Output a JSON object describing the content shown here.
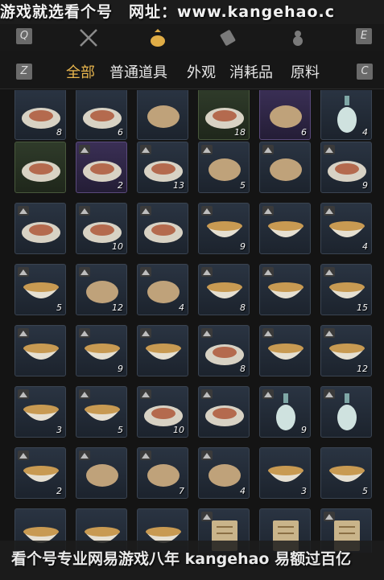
{
  "banner": {
    "text": "游戏就选看个号　网址：www.kangehao.c"
  },
  "keys": {
    "q": "Q",
    "e": "E",
    "z": "Z",
    "c": "C"
  },
  "top_icons": [
    "swords-icon",
    "pouch-icon",
    "scroll-icon",
    "gourd-icon"
  ],
  "categories": [
    {
      "label": "全部",
      "active": true
    },
    {
      "label": "普通道具",
      "active": false
    },
    {
      "label": "外观",
      "active": false
    },
    {
      "label": "消耗品",
      "active": false
    },
    {
      "label": "原料",
      "active": false
    }
  ],
  "items": [
    {
      "icon": "meat-plate-icon",
      "count": "8",
      "badge": false,
      "tier": "normal"
    },
    {
      "icon": "cucumber-plate-icon",
      "count": "6",
      "badge": false,
      "tier": "normal"
    },
    {
      "icon": "roast-meat-icon",
      "count": "",
      "badge": false,
      "tier": "normal"
    },
    {
      "icon": "stirfry-plate-icon",
      "count": "18",
      "badge": false,
      "tier": "green"
    },
    {
      "icon": "mountain-emblem-icon",
      "count": "6",
      "badge": false,
      "tier": "rare"
    },
    {
      "icon": "vase-icon",
      "count": "4",
      "badge": false,
      "tier": "normal"
    },
    {
      "icon": "dumpling-plate-icon",
      "count": "",
      "badge": false,
      "tier": "green"
    },
    {
      "icon": "pastry-tray-icon",
      "count": "2",
      "badge": true,
      "tier": "rare"
    },
    {
      "icon": "sliced-meat-plate-icon",
      "count": "13",
      "badge": true,
      "tier": "normal"
    },
    {
      "icon": "mixed-dish-icon",
      "count": "5",
      "badge": true,
      "tier": "normal"
    },
    {
      "icon": "braised-meat-icon",
      "count": "",
      "badge": true,
      "tier": "normal"
    },
    {
      "icon": "cake-tray-icon",
      "count": "9",
      "badge": true,
      "tier": "normal"
    },
    {
      "icon": "toast-plate-icon",
      "count": "",
      "badge": true,
      "tier": "normal"
    },
    {
      "icon": "fish-plate-icon",
      "count": "10",
      "badge": true,
      "tier": "normal"
    },
    {
      "icon": "fish-plate-icon",
      "count": "",
      "badge": true,
      "tier": "normal"
    },
    {
      "icon": "soup-bowl-icon",
      "count": "9",
      "badge": true,
      "tier": "normal"
    },
    {
      "icon": "greens-bowl-icon",
      "count": "",
      "badge": true,
      "tier": "normal"
    },
    {
      "icon": "greens-bowl-icon",
      "count": "4",
      "badge": true,
      "tier": "normal"
    },
    {
      "icon": "porridge-bowl-icon",
      "count": "5",
      "badge": true,
      "tier": "normal"
    },
    {
      "icon": "pancake-stack-icon",
      "count": "12",
      "badge": true,
      "tier": "normal"
    },
    {
      "icon": "steamed-bun-icon",
      "count": "4",
      "badge": true,
      "tier": "normal"
    },
    {
      "icon": "noodle-bowl-icon",
      "count": "8",
      "badge": true,
      "tier": "normal"
    },
    {
      "icon": "noodle-bowl-icon",
      "count": "",
      "badge": true,
      "tier": "normal"
    },
    {
      "icon": "rice-bowl-icon",
      "count": "15",
      "badge": true,
      "tier": "normal"
    },
    {
      "icon": "red-soup-bowl-icon",
      "count": "",
      "badge": true,
      "tier": "normal"
    },
    {
      "icon": "red-berries-bowl-icon",
      "count": "9",
      "badge": true,
      "tier": "normal"
    },
    {
      "icon": "red-broth-cup-icon",
      "count": "",
      "badge": true,
      "tier": "normal"
    },
    {
      "icon": "ham-slices-plate-icon",
      "count": "8",
      "badge": true,
      "tier": "normal"
    },
    {
      "icon": "stew-bowl-icon",
      "count": "",
      "badge": true,
      "tier": "normal"
    },
    {
      "icon": "tangyuan-bowl-icon",
      "count": "12",
      "badge": true,
      "tier": "normal"
    },
    {
      "icon": "broth-bowl-icon",
      "count": "3",
      "badge": true,
      "tier": "normal"
    },
    {
      "icon": "tea-bowl-icon",
      "count": "5",
      "badge": true,
      "tier": "normal"
    },
    {
      "icon": "mushroom-plate-icon",
      "count": "10",
      "badge": true,
      "tier": "normal"
    },
    {
      "icon": "meat-plate-icon",
      "count": "",
      "badge": true,
      "tier": "normal"
    },
    {
      "icon": "celadon-vase-icon",
      "count": "9",
      "badge": true,
      "tier": "normal"
    },
    {
      "icon": "celadon-vase-icon",
      "count": "",
      "badge": true,
      "tier": "normal"
    },
    {
      "icon": "tofu-pot-icon",
      "count": "2",
      "badge": true,
      "tier": "normal"
    },
    {
      "icon": "fried-cubes-icon",
      "count": "",
      "badge": true,
      "tier": "normal"
    },
    {
      "icon": "fried-chunks-icon",
      "count": "7",
      "badge": true,
      "tier": "normal"
    },
    {
      "icon": "pancake-stack-icon",
      "count": "4",
      "badge": true,
      "tier": "normal"
    },
    {
      "icon": "porcelain-bowl-icon",
      "count": "3",
      "badge": false,
      "tier": "normal"
    },
    {
      "icon": "porcelain-bowl-icon",
      "count": "5",
      "badge": false,
      "tier": "normal"
    },
    {
      "icon": "rooster-bowl-icon",
      "count": "",
      "badge": false,
      "tier": "normal"
    },
    {
      "icon": "white-bowl-icon",
      "count": "",
      "badge": false,
      "tier": "normal"
    },
    {
      "icon": "lidded-bowl-icon",
      "count": "",
      "badge": false,
      "tier": "normal"
    },
    {
      "icon": "book-icon",
      "count": "",
      "badge": true,
      "tier": "normal"
    },
    {
      "icon": "scroll-icon",
      "count": "",
      "badge": false,
      "tier": "normal"
    },
    {
      "icon": "book-icon",
      "count": "",
      "badge": true,
      "tier": "normal"
    }
  ],
  "footer": {
    "text": "看个号专业网易游戏八年 kangehao 易额过百亿"
  }
}
